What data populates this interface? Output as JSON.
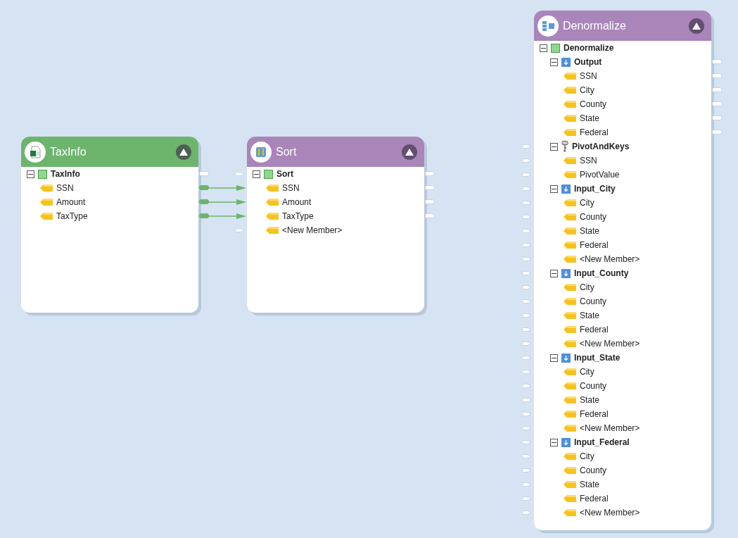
{
  "nodes": [
    {
      "title": "TaxInfo",
      "kind": "excel",
      "expanded": true,
      "rows": [
        {
          "label": "TaxInfo",
          "kind": "entity",
          "expanded": true,
          "out_port": true,
          "children": [
            {
              "label": "SSN",
              "kind": "member",
              "out_port": true,
              "out_linked": true
            },
            {
              "label": "Amount",
              "kind": "member",
              "out_port": true,
              "out_linked": true
            },
            {
              "label": "TaxType",
              "kind": "member",
              "out_port": true,
              "out_linked": true
            }
          ]
        }
      ]
    },
    {
      "title": "Sort",
      "kind": "sort",
      "expanded": true,
      "rows": [
        {
          "label": "Sort",
          "kind": "entity",
          "expanded": true,
          "in_port": true,
          "out_port": true,
          "children": [
            {
              "label": "SSN",
              "kind": "member",
              "in_port": true,
              "in_linked": true,
              "out_port": true
            },
            {
              "label": "Amount",
              "kind": "member",
              "in_port": true,
              "in_linked": true,
              "out_port": true
            },
            {
              "label": "TaxType",
              "kind": "member",
              "in_port": true,
              "in_linked": true,
              "out_port": true
            },
            {
              "label": "<New Member>",
              "kind": "member",
              "in_port": true
            }
          ]
        }
      ]
    },
    {
      "title": "Denormalize",
      "kind": "denormalize",
      "expanded": true,
      "rows": [
        {
          "label": "Denormalize",
          "kind": "entity",
          "expanded": true,
          "children": [
            {
              "label": "Output",
              "kind": "output",
              "expanded": true,
              "out_port": true,
              "children": [
                {
                  "label": "SSN",
                  "kind": "member",
                  "out_port": true
                },
                {
                  "label": "City",
                  "kind": "member",
                  "out_port": true
                },
                {
                  "label": "County",
                  "kind": "member",
                  "out_port": true
                },
                {
                  "label": "State",
                  "kind": "member",
                  "out_port": true
                },
                {
                  "label": "Federal",
                  "kind": "member",
                  "out_port": true
                }
              ]
            },
            {
              "label": "PivotAndKeys",
              "kind": "key",
              "expanded": true,
              "in_port": true,
              "children": [
                {
                  "label": "SSN",
                  "kind": "member",
                  "in_port": true
                },
                {
                  "label": "PivotValue",
                  "kind": "member",
                  "in_port": true
                }
              ]
            },
            {
              "label": "Input_City",
              "kind": "input",
              "expanded": true,
              "in_port": true,
              "children": [
                {
                  "label": "City",
                  "kind": "member",
                  "in_port": true
                },
                {
                  "label": "County",
                  "kind": "member",
                  "in_port": true
                },
                {
                  "label": "State",
                  "kind": "member",
                  "in_port": true
                },
                {
                  "label": "Federal",
                  "kind": "member",
                  "in_port": true
                },
                {
                  "label": "<New Member>",
                  "kind": "member",
                  "in_port": true
                }
              ]
            },
            {
              "label": "Input_County",
              "kind": "input",
              "expanded": true,
              "in_port": true,
              "children": [
                {
                  "label": "City",
                  "kind": "member",
                  "in_port": true
                },
                {
                  "label": "County",
                  "kind": "member",
                  "in_port": true
                },
                {
                  "label": "State",
                  "kind": "member",
                  "in_port": true
                },
                {
                  "label": "Federal",
                  "kind": "member",
                  "in_port": true
                },
                {
                  "label": "<New Member>",
                  "kind": "member",
                  "in_port": true
                }
              ]
            },
            {
              "label": "Input_State",
              "kind": "input",
              "expanded": true,
              "in_port": true,
              "children": [
                {
                  "label": "City",
                  "kind": "member",
                  "in_port": true
                },
                {
                  "label": "County",
                  "kind": "member",
                  "in_port": true
                },
                {
                  "label": "State",
                  "kind": "member",
                  "in_port": true
                },
                {
                  "label": "Federal",
                  "kind": "member",
                  "in_port": true
                },
                {
                  "label": "<New Member>",
                  "kind": "member",
                  "in_port": true
                }
              ]
            },
            {
              "label": "Input_Federal",
              "kind": "input",
              "expanded": true,
              "in_port": true,
              "children": [
                {
                  "label": "City",
                  "kind": "member",
                  "in_port": true
                },
                {
                  "label": "County",
                  "kind": "member",
                  "in_port": true
                },
                {
                  "label": "State",
                  "kind": "member",
                  "in_port": true
                },
                {
                  "label": "Federal",
                  "kind": "member",
                  "in_port": true
                },
                {
                  "label": "<New Member>",
                  "kind": "member",
                  "in_port": true
                }
              ]
            }
          ]
        }
      ]
    }
  ]
}
